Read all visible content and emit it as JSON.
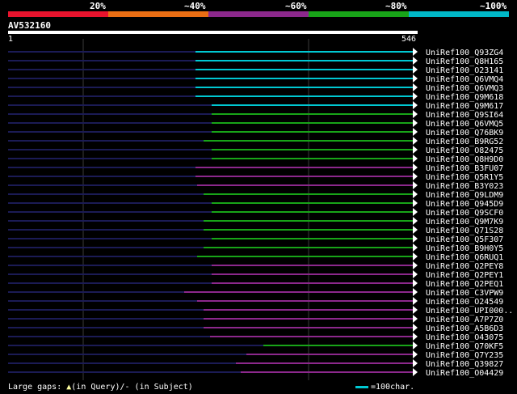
{
  "coverage_scale": {
    "labels": [
      "20%",
      "~40%",
      "~60%",
      "~80%",
      "~100%"
    ],
    "colors": [
      "#e8132d",
      "#ea6e14",
      "#8c288c",
      "#18a418",
      "#00b8c8"
    ]
  },
  "query": {
    "accession": "AV532160",
    "start": "1",
    "end": "546"
  },
  "hits": [
    {
      "name": "UniRef100_Q93ZG4",
      "start": 242,
      "color": "#00c8d2"
    },
    {
      "name": "UniRef100_Q8H165",
      "start": 242,
      "color": "#00c8d2"
    },
    {
      "name": "UniRef100_O23141",
      "start": 242,
      "color": "#00c8d2"
    },
    {
      "name": "UniRef100_Q6VMQ4",
      "start": 242,
      "color": "#00c8d2"
    },
    {
      "name": "UniRef100_Q6VMQ3",
      "start": 242,
      "color": "#00c8d2"
    },
    {
      "name": "UniRef100_Q9M618",
      "start": 242,
      "color": "#00c8d2"
    },
    {
      "name": "UniRef100_Q9M617",
      "start": 262,
      "color": "#00c8d2"
    },
    {
      "name": "UniRef100_Q9SI64",
      "start": 262,
      "color": "#18a418"
    },
    {
      "name": "UniRef100_Q6VMQ5",
      "start": 262,
      "color": "#18a418"
    },
    {
      "name": "UniRef100_Q76BK9",
      "start": 262,
      "color": "#18a418"
    },
    {
      "name": "UniRef100_B9RG52",
      "start": 252,
      "color": "#18a418"
    },
    {
      "name": "UniRef100_O82475",
      "start": 262,
      "color": "#18a418"
    },
    {
      "name": "UniRef100_Q8H9D0",
      "start": 262,
      "color": "#18a418"
    },
    {
      "name": "UniRef100_B3FU07",
      "start": 242,
      "color": "#8c288c"
    },
    {
      "name": "UniRef100_Q5R1Y5",
      "start": 242,
      "color": "#8c288c"
    },
    {
      "name": "UniRef100_B3Y023",
      "start": 244,
      "color": "#8c288c"
    },
    {
      "name": "UniRef100_Q9LDM9",
      "start": 252,
      "color": "#18a418"
    },
    {
      "name": "UniRef100_Q945D9",
      "start": 262,
      "color": "#18a418"
    },
    {
      "name": "UniRef100_Q9SCF0",
      "start": 262,
      "color": "#18a418"
    },
    {
      "name": "UniRef100_Q9M7K9",
      "start": 252,
      "color": "#18a418"
    },
    {
      "name": "UniRef100_Q71S28",
      "start": 252,
      "color": "#18a418"
    },
    {
      "name": "UniRef100_Q5F307",
      "start": 262,
      "color": "#18a418"
    },
    {
      "name": "UniRef100_B9H0Y5",
      "start": 252,
      "color": "#18a418"
    },
    {
      "name": "UniRef100_Q6RUQ1",
      "start": 244,
      "color": "#18a418"
    },
    {
      "name": "UniRef100_Q2PEY8",
      "start": 262,
      "color": "#8c288c"
    },
    {
      "name": "UniRef100_Q2PEY1",
      "start": 262,
      "color": "#8c288c"
    },
    {
      "name": "UniRef100_Q2PEQ1",
      "start": 262,
      "color": "#8c288c"
    },
    {
      "name": "UniRef100_C3VPW9",
      "start": 228,
      "color": "#8c288c"
    },
    {
      "name": "UniRef100_O24549",
      "start": 244,
      "color": "#8c288c"
    },
    {
      "name": "UniRef100_UPI000..",
      "start": 252,
      "color": "#8c288c"
    },
    {
      "name": "UniRef100_A7P7Z0",
      "start": 252,
      "color": "#8c288c"
    },
    {
      "name": "UniRef100_A5B6D3",
      "start": 252,
      "color": "#8c288c"
    },
    {
      "name": "UniRef100_O43075",
      "start": 260,
      "color": "#8c288c"
    },
    {
      "name": "UniRef100_Q70KF5",
      "start": 326,
      "color": "#18a418"
    },
    {
      "name": "UniRef100_Q7Y235",
      "start": 305,
      "color": "#8c288c"
    },
    {
      "name": "UniRef100_Q39827",
      "start": 292,
      "color": "#8c288c"
    },
    {
      "name": "UniRef100_O04429",
      "start": 298,
      "color": "#8c288c"
    }
  ],
  "legend": {
    "gaps_text": "Large gaps: ",
    "in_query": "(in Query)/- (in Subject)",
    "scale_text": "=100char."
  }
}
